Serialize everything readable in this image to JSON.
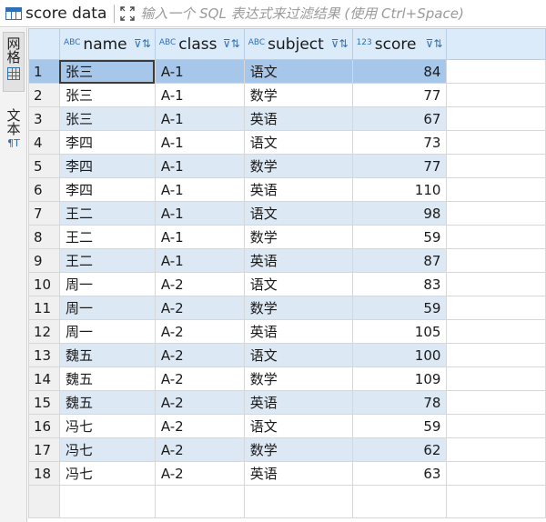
{
  "tab": {
    "title": "score data",
    "icon": "table-icon"
  },
  "filter": {
    "placeholder": "输入一个 SQL 表达式来过滤结果 (使用 Ctrl+Space)"
  },
  "side_panel": {
    "grid_label": "网格",
    "text_label": "文本"
  },
  "columns": [
    {
      "type_tag": "ABC",
      "label": "name",
      "align": "left"
    },
    {
      "type_tag": "ABC",
      "label": "class",
      "align": "left"
    },
    {
      "type_tag": "ABC",
      "label": "subject",
      "align": "left"
    },
    {
      "type_tag": "123",
      "label": "score",
      "align": "right"
    }
  ],
  "rows": [
    {
      "num": "1",
      "cells": [
        "张三",
        "A-1",
        "语文",
        "84"
      ]
    },
    {
      "num": "2",
      "cells": [
        "张三",
        "A-1",
        "数学",
        "77"
      ]
    },
    {
      "num": "3",
      "cells": [
        "张三",
        "A-1",
        "英语",
        "67"
      ]
    },
    {
      "num": "4",
      "cells": [
        "李四",
        "A-1",
        "语文",
        "73"
      ]
    },
    {
      "num": "5",
      "cells": [
        "李四",
        "A-1",
        "数学",
        "77"
      ]
    },
    {
      "num": "6",
      "cells": [
        "李四",
        "A-1",
        "英语",
        "110"
      ]
    },
    {
      "num": "7",
      "cells": [
        "王二",
        "A-1",
        "语文",
        "98"
      ]
    },
    {
      "num": "8",
      "cells": [
        "王二",
        "A-1",
        "数学",
        "59"
      ]
    },
    {
      "num": "9",
      "cells": [
        "王二",
        "A-1",
        "英语",
        "87"
      ]
    },
    {
      "num": "10",
      "cells": [
        "周一",
        "A-2",
        "语文",
        "83"
      ]
    },
    {
      "num": "11",
      "cells": [
        "周一",
        "A-2",
        "数学",
        "59"
      ]
    },
    {
      "num": "12",
      "cells": [
        "周一",
        "A-2",
        "英语",
        "105"
      ]
    },
    {
      "num": "13",
      "cells": [
        "魏五",
        "A-2",
        "语文",
        "100"
      ]
    },
    {
      "num": "14",
      "cells": [
        "魏五",
        "A-2",
        "数学",
        "109"
      ]
    },
    {
      "num": "15",
      "cells": [
        "魏五",
        "A-2",
        "英语",
        "78"
      ]
    },
    {
      "num": "16",
      "cells": [
        "冯七",
        "A-2",
        "语文",
        "59"
      ]
    },
    {
      "num": "17",
      "cells": [
        "冯七",
        "A-2",
        "数学",
        "62"
      ]
    },
    {
      "num": "18",
      "cells": [
        "冯七",
        "A-2",
        "英语",
        "63"
      ]
    }
  ],
  "selected_row": 1,
  "colors": {
    "header_bg": "#dcebfa",
    "alt_row_bg": "#dde8f5",
    "selected_bg": "#a7c7ea",
    "accent": "#2f6fb3"
  }
}
